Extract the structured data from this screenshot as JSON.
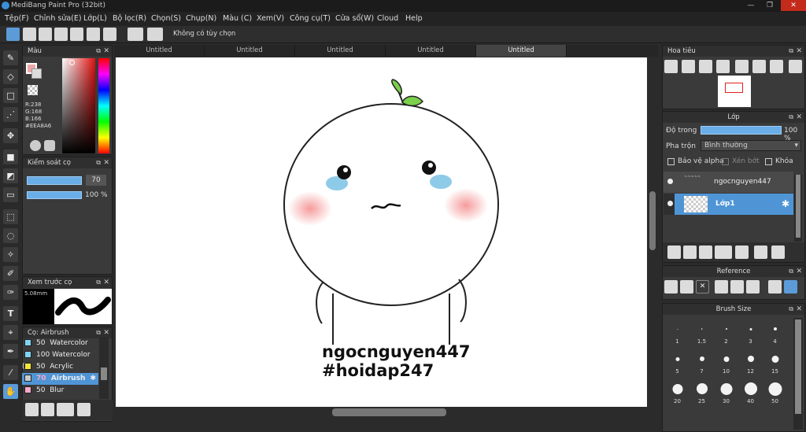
{
  "window": {
    "title": "MediBang Paint Pro (32bit)",
    "controls": [
      "—",
      "❐",
      "✕"
    ]
  },
  "menu": [
    "Tệp(F)",
    "Chỉnh sửa(E)",
    "Lớp(L)",
    "Bộ lọc(R)",
    "Chọn(S)",
    "Chụp(N)",
    "Màu (C)",
    "Xem(V)",
    "Công cụ(T)",
    "Cửa sổ(W)",
    "Cloud",
    "Help"
  ],
  "toolbar": {
    "option_text": "Không có tùy chọn"
  },
  "color_panel": {
    "title": "Màu",
    "r": "R:238",
    "g": "G:168",
    "b": "B:166",
    "hex": "#EEA8A6",
    "primary_color": "#EEA8A6"
  },
  "brush_control": {
    "title": "Kiểm soát cọ",
    "size_value": "70",
    "opacity_value": "100 %"
  },
  "preview_panel": {
    "title": "Xem trước cọ",
    "size": "5.08mm"
  },
  "brush_panel": {
    "title": "Cọ: Airbrush",
    "items": [
      {
        "size": "50",
        "name": "Watercolor",
        "color": "#7fd3f5"
      },
      {
        "size": "100",
        "name": "Watercolor (W",
        "color": "#7fd3f5"
      },
      {
        "size": "50",
        "name": "Acrylic",
        "color": "#f5e53a"
      },
      {
        "size": "70",
        "name": "Airbrush",
        "color": "#f5a8c8",
        "selected": true
      },
      {
        "size": "50",
        "name": "Blur",
        "color": "#f5a8c8"
      }
    ]
  },
  "tabs": [
    "Untitled",
    "Untitled",
    "Untitled",
    "Untitled",
    "Untitled"
  ],
  "canvas": {
    "line1": "ngocnguyen447",
    "line2": "#hoidap247"
  },
  "navigator": {
    "title": "Hoa tiêu"
  },
  "layer_panel": {
    "title": "Lớp",
    "opacity_label": "Độ trong",
    "opacity_value": "100 %",
    "opacity_fraction": 1.0,
    "blend_label": "Pha trộn",
    "blend_value": "Bình thường",
    "chk_alpha": "Bảo vệ alpha",
    "chk_clip": "Xén bớt",
    "chk_lock": "Khóa",
    "layers": [
      {
        "name": "ngocnguyen447",
        "selected": false
      },
      {
        "name": "Lớp1",
        "selected": true
      }
    ]
  },
  "reference_panel": {
    "title": "Reference"
  },
  "brush_size_panel": {
    "title": "Brush Size",
    "sizes": [
      "1",
      "1.5",
      "2",
      "3",
      "4",
      "5",
      "7",
      "10",
      "12",
      "15",
      "20",
      "25",
      "30",
      "40",
      "50"
    ]
  }
}
